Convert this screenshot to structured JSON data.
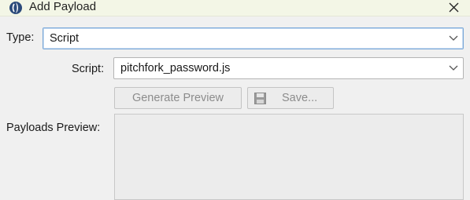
{
  "window": {
    "title": "Add Payload",
    "icon": "burp-logo-icon",
    "close_glyph": "✕"
  },
  "form": {
    "type_label": "Type:",
    "type_value": "Script",
    "script_label": "Script:",
    "script_value": "pitchfork_password.js",
    "generate_button": "Generate Preview",
    "save_button": "Save...",
    "preview_label": "Payloads Preview:"
  },
  "colors": {
    "titlebar": "#f3f6e6",
    "focus_border": "#7aa8d8",
    "background": "#f0f0f0"
  }
}
